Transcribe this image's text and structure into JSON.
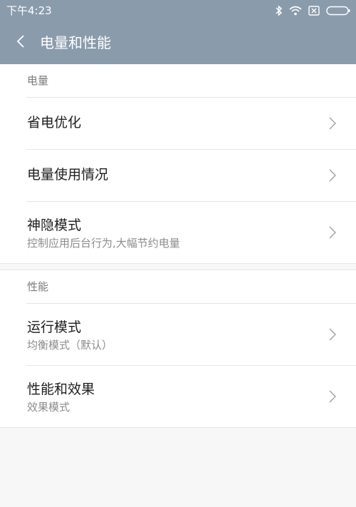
{
  "status_bar": {
    "time": "下午4:23",
    "icons": [
      "bluetooth-icon",
      "wifi-icon",
      "no-sim-icon",
      "battery-icon"
    ]
  },
  "header": {
    "back_icon": "chevron-left-icon",
    "title": "电量和性能",
    "background_color": "#8a9bac"
  },
  "sections": [
    {
      "header": "电量",
      "items": [
        {
          "title": "省电优化"
        },
        {
          "title": "电量使用情况"
        },
        {
          "title": "神隐模式",
          "subtitle": "控制应用后台行为,大幅节约电量"
        }
      ]
    },
    {
      "header": "性能",
      "items": [
        {
          "title": "运行模式",
          "subtitle": "均衡模式（默认）"
        },
        {
          "title": "性能和效果",
          "subtitle": "效果模式"
        }
      ]
    }
  ]
}
